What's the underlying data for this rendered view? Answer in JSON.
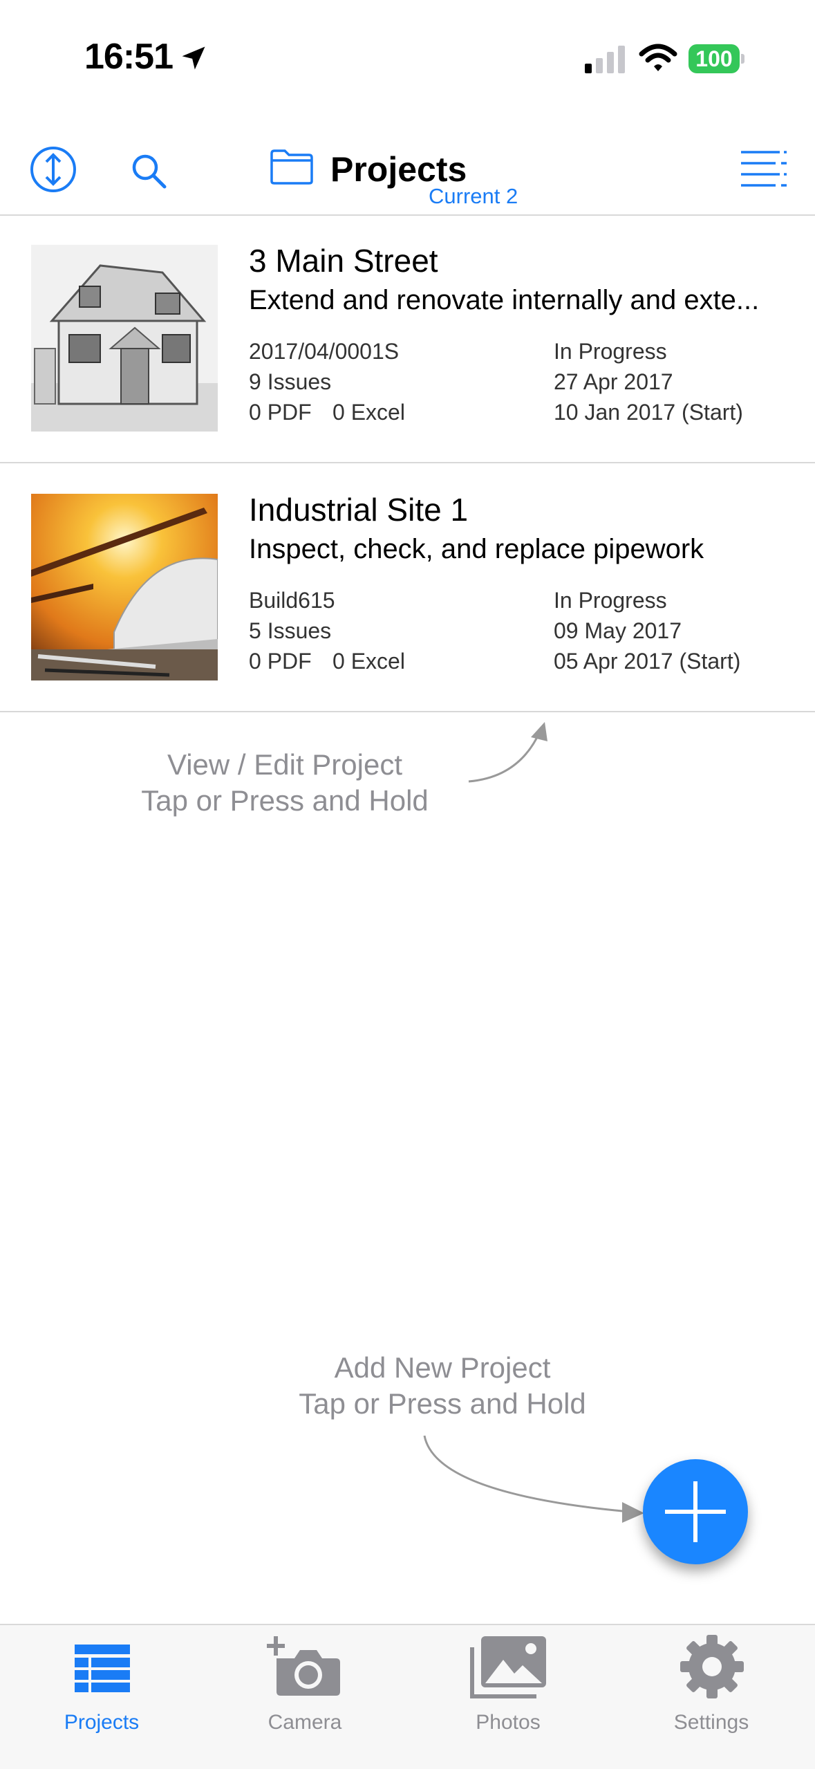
{
  "status_bar": {
    "time": "16:51",
    "battery": "100"
  },
  "header": {
    "title": "Projects",
    "subtitle": "Current 2"
  },
  "projects": [
    {
      "title": "3 Main Street",
      "description": "Extend and renovate internally and exte...",
      "ref": "2017/04/0001S",
      "issues": "9 Issues",
      "pdf": "0 PDF",
      "excel": "0 Excel",
      "status": "In Progress",
      "date": "27 Apr 2017",
      "start": "10 Jan 2017 (Start)"
    },
    {
      "title": "Industrial Site 1",
      "description": "Inspect, check, and replace pipework",
      "ref": "Build615",
      "issues": "5 Issues",
      "pdf": "0 PDF",
      "excel": "0 Excel",
      "status": "In Progress",
      "date": "09 May 2017",
      "start": "05 Apr 2017 (Start)"
    }
  ],
  "hints": {
    "edit_line1": "View / Edit Project",
    "edit_line2": "Tap or Press and Hold",
    "add_line1": "Add New Project",
    "add_line2": "Tap or Press and Hold"
  },
  "tabs": [
    {
      "label": "Projects",
      "icon": "list-icon",
      "active": true
    },
    {
      "label": "Camera",
      "icon": "camera-add-icon",
      "active": false
    },
    {
      "label": "Photos",
      "icon": "photos-icon",
      "active": false
    },
    {
      "label": "Settings",
      "icon": "gear-icon",
      "active": false
    }
  ],
  "colors": {
    "accent": "#1a7cf5",
    "fab": "#1a86ff",
    "battery": "#34c759",
    "hint": "#8e8e93"
  }
}
